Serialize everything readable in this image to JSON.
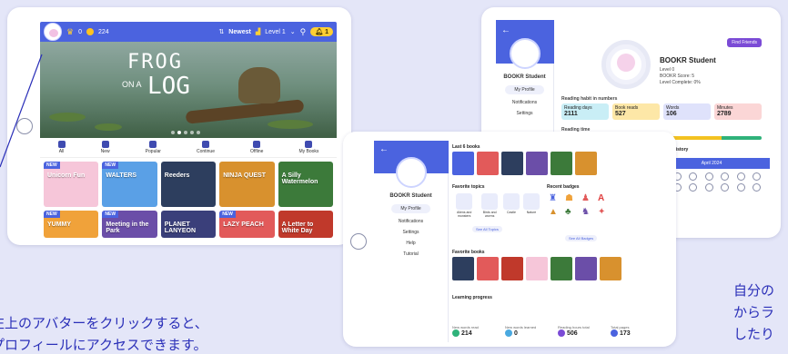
{
  "home_screen": {
    "topbar": {
      "crown_count": "0",
      "coin_count": "224",
      "sort_label": "Newest",
      "level_label": "Level 1",
      "notifications": "1"
    },
    "hero": {
      "title_line1": "FROG",
      "title_on_a": "ON A",
      "title_line2": "LOG"
    },
    "tabs": [
      "All",
      "New",
      "Popular",
      "Continue",
      "Offline",
      "My Books"
    ],
    "books": [
      {
        "badge": "NEW",
        "title": "Unicorn Fun",
        "color": "#f6c6d9"
      },
      {
        "badge": "NEW",
        "title": "WALTERS",
        "color": "#5aa0e6"
      },
      {
        "badge": "",
        "title": "Reeders",
        "color": "#2d3e5e"
      },
      {
        "badge": "",
        "title": "NINJA QUEST",
        "color": "#d8912e"
      },
      {
        "badge": "",
        "title": "A Silly Watermelon",
        "color": "#3c7a3a"
      },
      {
        "badge": "NEW",
        "title": "YUMMY",
        "color": "#f0a23a"
      },
      {
        "badge": "NEW",
        "title": "Meeting in the Park",
        "color": "#6b4ea8"
      },
      {
        "badge": "",
        "title": "PLANET LANYEON",
        "color": "#3a3f7a"
      },
      {
        "badge": "NEW",
        "title": "LAZY PEACH",
        "color": "#e25a5a"
      },
      {
        "badge": "",
        "title": "A Letter to White Day",
        "color": "#c0392b"
      }
    ]
  },
  "profile_back": {
    "student_name": "BOOKR Student",
    "side_items": [
      "My Profile",
      "Notifications",
      "Settings"
    ],
    "level_line": "Level 0",
    "score_line": "BOOKR Score: 5",
    "progress_line": "Level Complete: 0%",
    "edit_button": "Find Friends",
    "section_reading": "Reading habit in numbers",
    "stats": [
      {
        "label": "Reading days",
        "value": "2111",
        "color": "#c9eef6"
      },
      {
        "label": "Book reads",
        "value": "527",
        "color": "#fde7a7"
      },
      {
        "label": "Words",
        "value": "106",
        "color": "#dfe2fb"
      },
      {
        "label": "Minutes",
        "value": "2789",
        "color": "#fbd6d6"
      }
    ],
    "section_time": "Reading time",
    "history_title": "Reading History",
    "calendar_month": "April 2024"
  },
  "profile_front": {
    "student_name": "BOOKR Student",
    "side_items": [
      "My Profile",
      "Notifications",
      "Settings",
      "Help",
      "Tutorial"
    ],
    "section_last": "Last 6 books",
    "section_topics": "Favorite topics",
    "topics": [
      "Aliens and monsters",
      "Birds and worms",
      "Castle",
      "Nature"
    ],
    "see_all_topics": "See All Topics",
    "section_badges": "Recent badges",
    "see_all_badges": "See All Badges",
    "section_fav_books": "Favorite books",
    "section_learning": "Learning progress",
    "learning": [
      {
        "label": "New words read",
        "value": "214",
        "color": "#2fb27a"
      },
      {
        "label": "New words learned",
        "value": "0",
        "color": "#4aa9e0"
      },
      {
        "label": "Reading hours total",
        "value": "506",
        "color": "#7b4bd6"
      },
      {
        "label": "Total pages",
        "value": "173",
        "color": "#4b63df"
      }
    ]
  },
  "captions": {
    "left_line1": "左上のアバターをクリックすると、",
    "left_line2": "プロフィールにアクセスできます。",
    "right_line1": "自分の",
    "right_line2": "からラ",
    "right_line3": "したり"
  }
}
